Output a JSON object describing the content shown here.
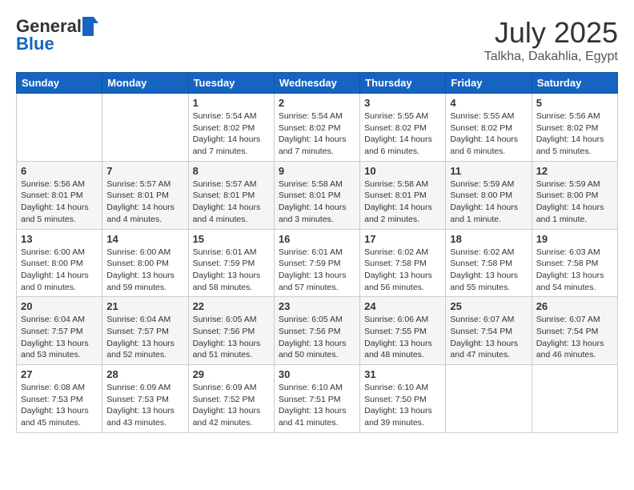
{
  "header": {
    "logo_line1": "General",
    "logo_line2": "Blue",
    "month": "July 2025",
    "location": "Talkha, Dakahlia, Egypt"
  },
  "weekdays": [
    "Sunday",
    "Monday",
    "Tuesday",
    "Wednesday",
    "Thursday",
    "Friday",
    "Saturday"
  ],
  "weeks": [
    [
      {
        "day": "",
        "info": ""
      },
      {
        "day": "",
        "info": ""
      },
      {
        "day": "1",
        "info": "Sunrise: 5:54 AM\nSunset: 8:02 PM\nDaylight: 14 hours\nand 7 minutes."
      },
      {
        "day": "2",
        "info": "Sunrise: 5:54 AM\nSunset: 8:02 PM\nDaylight: 14 hours\nand 7 minutes."
      },
      {
        "day": "3",
        "info": "Sunrise: 5:55 AM\nSunset: 8:02 PM\nDaylight: 14 hours\nand 6 minutes."
      },
      {
        "day": "4",
        "info": "Sunrise: 5:55 AM\nSunset: 8:02 PM\nDaylight: 14 hours\nand 6 minutes."
      },
      {
        "day": "5",
        "info": "Sunrise: 5:56 AM\nSunset: 8:02 PM\nDaylight: 14 hours\nand 5 minutes."
      }
    ],
    [
      {
        "day": "6",
        "info": "Sunrise: 5:56 AM\nSunset: 8:01 PM\nDaylight: 14 hours\nand 5 minutes."
      },
      {
        "day": "7",
        "info": "Sunrise: 5:57 AM\nSunset: 8:01 PM\nDaylight: 14 hours\nand 4 minutes."
      },
      {
        "day": "8",
        "info": "Sunrise: 5:57 AM\nSunset: 8:01 PM\nDaylight: 14 hours\nand 4 minutes."
      },
      {
        "day": "9",
        "info": "Sunrise: 5:58 AM\nSunset: 8:01 PM\nDaylight: 14 hours\nand 3 minutes."
      },
      {
        "day": "10",
        "info": "Sunrise: 5:58 AM\nSunset: 8:01 PM\nDaylight: 14 hours\nand 2 minutes."
      },
      {
        "day": "11",
        "info": "Sunrise: 5:59 AM\nSunset: 8:00 PM\nDaylight: 14 hours\nand 1 minute."
      },
      {
        "day": "12",
        "info": "Sunrise: 5:59 AM\nSunset: 8:00 PM\nDaylight: 14 hours\nand 1 minute."
      }
    ],
    [
      {
        "day": "13",
        "info": "Sunrise: 6:00 AM\nSunset: 8:00 PM\nDaylight: 14 hours\nand 0 minutes."
      },
      {
        "day": "14",
        "info": "Sunrise: 6:00 AM\nSunset: 8:00 PM\nDaylight: 13 hours\nand 59 minutes."
      },
      {
        "day": "15",
        "info": "Sunrise: 6:01 AM\nSunset: 7:59 PM\nDaylight: 13 hours\nand 58 minutes."
      },
      {
        "day": "16",
        "info": "Sunrise: 6:01 AM\nSunset: 7:59 PM\nDaylight: 13 hours\nand 57 minutes."
      },
      {
        "day": "17",
        "info": "Sunrise: 6:02 AM\nSunset: 7:58 PM\nDaylight: 13 hours\nand 56 minutes."
      },
      {
        "day": "18",
        "info": "Sunrise: 6:02 AM\nSunset: 7:58 PM\nDaylight: 13 hours\nand 55 minutes."
      },
      {
        "day": "19",
        "info": "Sunrise: 6:03 AM\nSunset: 7:58 PM\nDaylight: 13 hours\nand 54 minutes."
      }
    ],
    [
      {
        "day": "20",
        "info": "Sunrise: 6:04 AM\nSunset: 7:57 PM\nDaylight: 13 hours\nand 53 minutes."
      },
      {
        "day": "21",
        "info": "Sunrise: 6:04 AM\nSunset: 7:57 PM\nDaylight: 13 hours\nand 52 minutes."
      },
      {
        "day": "22",
        "info": "Sunrise: 6:05 AM\nSunset: 7:56 PM\nDaylight: 13 hours\nand 51 minutes."
      },
      {
        "day": "23",
        "info": "Sunrise: 6:05 AM\nSunset: 7:56 PM\nDaylight: 13 hours\nand 50 minutes."
      },
      {
        "day": "24",
        "info": "Sunrise: 6:06 AM\nSunset: 7:55 PM\nDaylight: 13 hours\nand 48 minutes."
      },
      {
        "day": "25",
        "info": "Sunrise: 6:07 AM\nSunset: 7:54 PM\nDaylight: 13 hours\nand 47 minutes."
      },
      {
        "day": "26",
        "info": "Sunrise: 6:07 AM\nSunset: 7:54 PM\nDaylight: 13 hours\nand 46 minutes."
      }
    ],
    [
      {
        "day": "27",
        "info": "Sunrise: 6:08 AM\nSunset: 7:53 PM\nDaylight: 13 hours\nand 45 minutes."
      },
      {
        "day": "28",
        "info": "Sunrise: 6:09 AM\nSunset: 7:53 PM\nDaylight: 13 hours\nand 43 minutes."
      },
      {
        "day": "29",
        "info": "Sunrise: 6:09 AM\nSunset: 7:52 PM\nDaylight: 13 hours\nand 42 minutes."
      },
      {
        "day": "30",
        "info": "Sunrise: 6:10 AM\nSunset: 7:51 PM\nDaylight: 13 hours\nand 41 minutes."
      },
      {
        "day": "31",
        "info": "Sunrise: 6:10 AM\nSunset: 7:50 PM\nDaylight: 13 hours\nand 39 minutes."
      },
      {
        "day": "",
        "info": ""
      },
      {
        "day": "",
        "info": ""
      }
    ]
  ]
}
